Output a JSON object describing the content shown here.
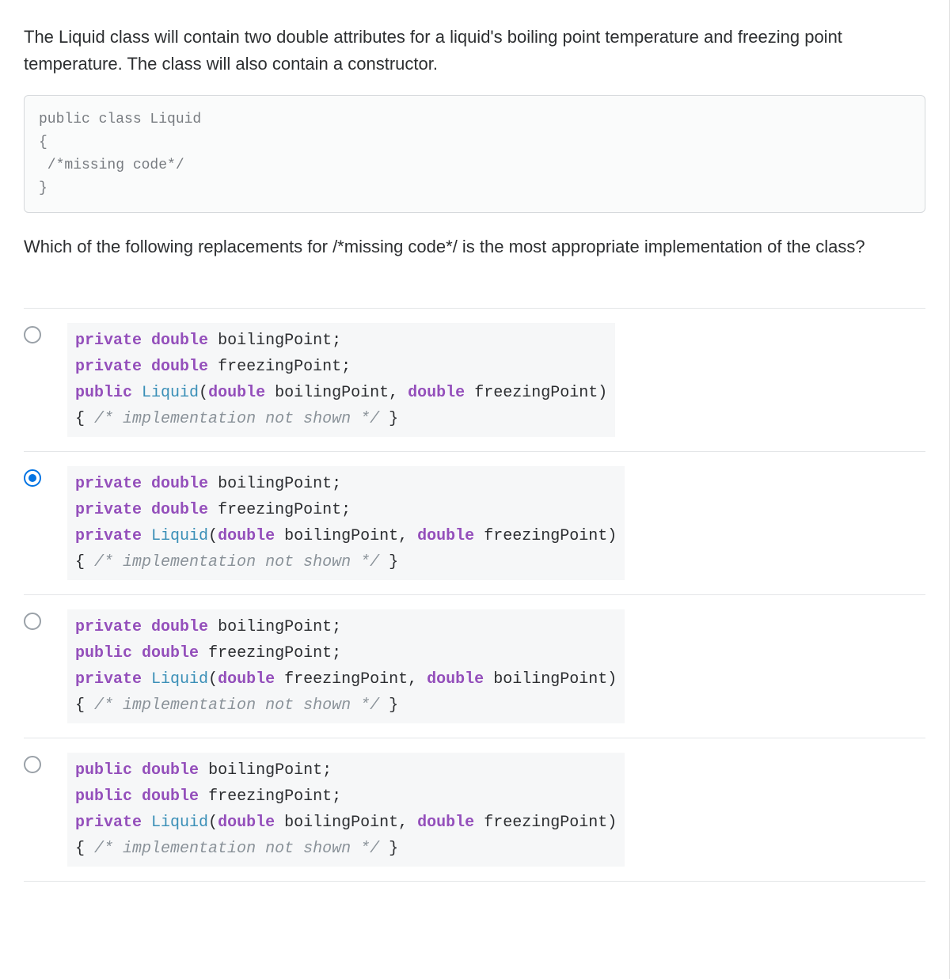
{
  "question": {
    "intro": "The Liquid class will contain two double attributes for a liquid's boiling point temperature and freezing point temperature. The class will also contain a constructor.",
    "code": "public class Liquid\n{\n /*missing code*/\n}",
    "followup": "Which of the following replacements for /*missing code*/ is the most appropriate implementation of the class?"
  },
  "tokens": {
    "private": "private",
    "public": "public",
    "double": "double",
    "Liquid": "Liquid",
    "boilingPoint": "boilingPoint",
    "freezingPoint": "freezingPoint",
    "semi": ";",
    "lparen": "(",
    "rparen": ")",
    "comma": ",",
    "lbrace": "{",
    "rbrace": "}",
    "impl_comment": "/* implementation not shown */"
  },
  "options": {
    "selected_index": 1,
    "list": [
      {
        "line1_mod": "private",
        "line2_mod": "private",
        "ctor_mod": "public",
        "param1": "boilingPoint",
        "param2": "freezingPoint"
      },
      {
        "line1_mod": "private",
        "line2_mod": "private",
        "ctor_mod": "private",
        "param1": "boilingPoint",
        "param2": "freezingPoint"
      },
      {
        "line1_mod": "private",
        "line2_mod": "public",
        "ctor_mod": "private",
        "param1": "freezingPoint",
        "param2": "boilingPoint"
      },
      {
        "line1_mod": "public",
        "line2_mod": "public",
        "ctor_mod": "private",
        "param1": "boilingPoint",
        "param2": "freezingPoint"
      }
    ]
  }
}
